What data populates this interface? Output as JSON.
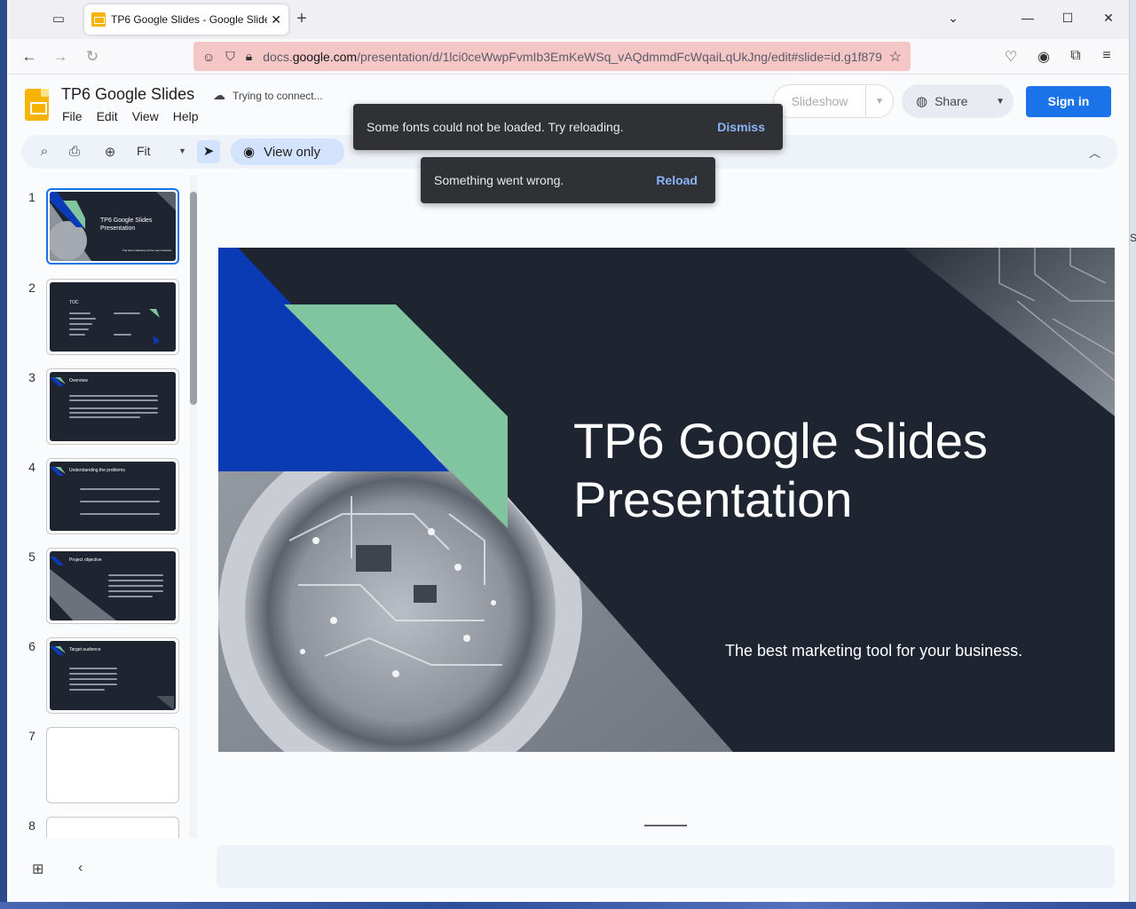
{
  "browser": {
    "tab_title": "TP6 Google Slides - Google Slides",
    "url_prefix": "docs.",
    "url_domain": "google.com",
    "url_path": "/presentation/d/1lci0ceWwpFvmIb3EmKeWSq_vAQdmmdFcWqaiLqUkJng/edit#slide=id.g1f879",
    "icons": {
      "tab_list": "tab-list-icon",
      "new_tab": "plus-icon",
      "back": "arrow-left-icon",
      "forward": "arrow-right-icon",
      "reload": "reload-icon",
      "star": "star-icon"
    }
  },
  "docs": {
    "title": "TP6 Google Slides",
    "status": "Trying to connect...",
    "menu": [
      "File",
      "Edit",
      "View",
      "Help"
    ],
    "slideshow_label": "Slideshow",
    "share_label": "Share",
    "signin_label": "Sign in"
  },
  "toolbar": {
    "zoom_label": "Fit",
    "view_only_label": "View only"
  },
  "snackbars": {
    "fonts": {
      "message": "Some fonts could not be loaded. Try reloading.",
      "action": "Dismiss"
    },
    "error": {
      "message": "Something went wrong.",
      "action": "Reload"
    }
  },
  "filmstrip": {
    "slides": [
      {
        "num": "1",
        "title": "TP6 Google Slides Presentation",
        "subtitle": "The best marketing tool for your business."
      },
      {
        "num": "2",
        "title": "TOC"
      },
      {
        "num": "3",
        "title": "Overview"
      },
      {
        "num": "4",
        "title": "Understanding the problems"
      },
      {
        "num": "5",
        "title": "Project objective"
      },
      {
        "num": "6",
        "title": "Target audience"
      },
      {
        "num": "7",
        "title": ""
      },
      {
        "num": "8",
        "title": ""
      }
    ]
  },
  "slide": {
    "title": "TP6 Google Slides\nPresentation",
    "subtitle": "The best marketing tool for your business.",
    "colors": {
      "background": "#1e2430",
      "blue": "#0a3bb5",
      "green": "#80c4a0"
    }
  }
}
